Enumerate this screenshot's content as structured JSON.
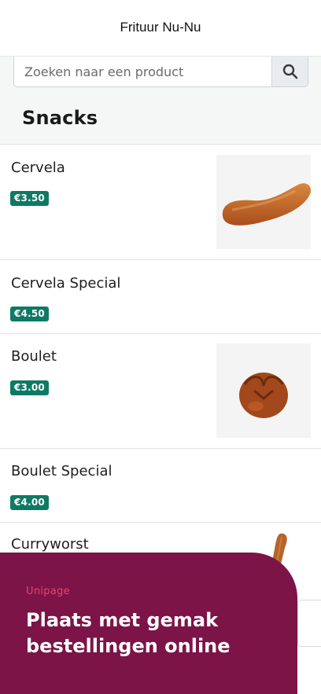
{
  "header": {
    "title": "Frituur Nu-Nu"
  },
  "search": {
    "placeholder": "Zoeken naar een product"
  },
  "section": {
    "title": "Snacks"
  },
  "products": [
    {
      "name": "Cervela",
      "price": "€3.50",
      "image": "sausage"
    },
    {
      "name": "Cervela Special",
      "price": "€4.50"
    },
    {
      "name": "Boulet",
      "price": "€3.00",
      "image": "meatball"
    },
    {
      "name": "Boulet Special",
      "price": "€4.00"
    },
    {
      "name": "Curryworst",
      "image": "curry-sausage"
    }
  ],
  "promo": {
    "brand": "Unipage",
    "headline": "Plaats met gemak bestellingen online"
  },
  "colors": {
    "accent": "#0f7a63",
    "promo_bg": "#7c1448",
    "brand_red": "#e8446c"
  }
}
